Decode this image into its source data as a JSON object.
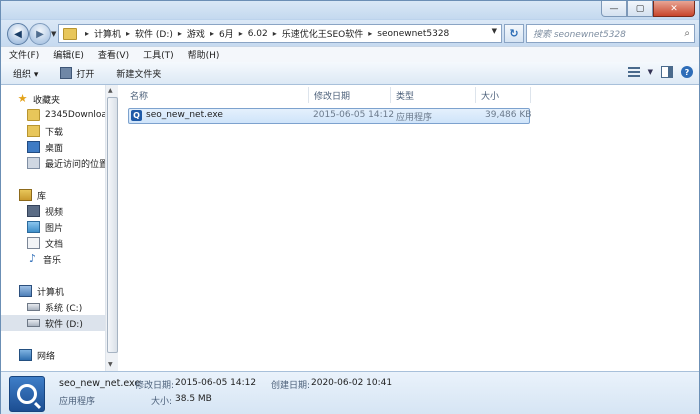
{
  "window": {
    "caption_buttons": [
      "—",
      "▢",
      "✕"
    ]
  },
  "navigation": {
    "back_icon": "back-arrow-icon",
    "forward_icon": "forward-arrow-icon"
  },
  "address": {
    "breadcrumbs": [
      "计算机",
      "软件 (D:)",
      "游戏",
      "6月",
      "6.02",
      "乐速优化王SEO软件",
      "seonewnet5328"
    ]
  },
  "search": {
    "placeholder": "搜索 seonewnet5328"
  },
  "menu": [
    "文件(F)",
    "编辑(E)",
    "查看(V)",
    "工具(T)",
    "帮助(H)"
  ],
  "toolbar": {
    "organize": "组织 ▾",
    "open": "打开",
    "new_folder": "新建文件夹"
  },
  "sidebar": {
    "favorites_label": "收藏夹",
    "favorites": [
      "2345Downloads",
      "下载",
      "桌面",
      "最近访问的位置"
    ],
    "libraries_label": "库",
    "libraries": [
      "视频",
      "图片",
      "文档",
      "音乐"
    ],
    "computer_label": "计算机",
    "drives": [
      "系统 (C:)",
      "软件 (D:)"
    ],
    "network_label": "网络"
  },
  "columns": [
    "名称",
    "修改日期",
    "类型",
    "大小"
  ],
  "files": [
    {
      "name": "seo_new_net.exe",
      "modified": "2015-06-05 14:12",
      "type": "应用程序",
      "size": "39,486 KB"
    }
  ],
  "details": {
    "filename": "seo_new_net.exe",
    "modified_label": "修改日期:",
    "modified": "2015-06-05 14:12",
    "created_label": "创建日期:",
    "created": "2020-06-02 10:41",
    "type": "应用程序",
    "size_label": "大小:",
    "size": "38.5 MB"
  }
}
